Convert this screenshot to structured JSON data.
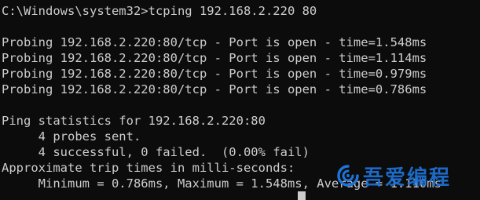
{
  "console": {
    "command_line": "C:\\Windows\\system32>tcping 192.168.2.220 80",
    "probes": [
      "Probing 192.168.2.220:80/tcp - Port is open - time=1.548ms",
      "Probing 192.168.2.220:80/tcp - Port is open - time=1.114ms",
      "Probing 192.168.2.220:80/tcp - Port is open - time=0.979ms",
      "Probing 192.168.2.220:80/tcp - Port is open - time=0.786ms"
    ],
    "stats_header": "Ping statistics for 192.168.2.220:80",
    "probes_sent": "     4 probes sent.",
    "probes_result": "     4 successful, 0 failed.  (0.00% fail)",
    "trip_header": "Approximate trip times in milli-seconds:",
    "trip_values": "     Minimum = 0.786ms, Maximum = 1.548ms, Average = 1.110ms"
  },
  "watermark": {
    "text": "吾爱编程",
    "color": "#1e73d6",
    "icon": "swirl-logo-icon"
  },
  "colors": {
    "background": "#0c0c0c",
    "foreground": "#cccccc"
  }
}
